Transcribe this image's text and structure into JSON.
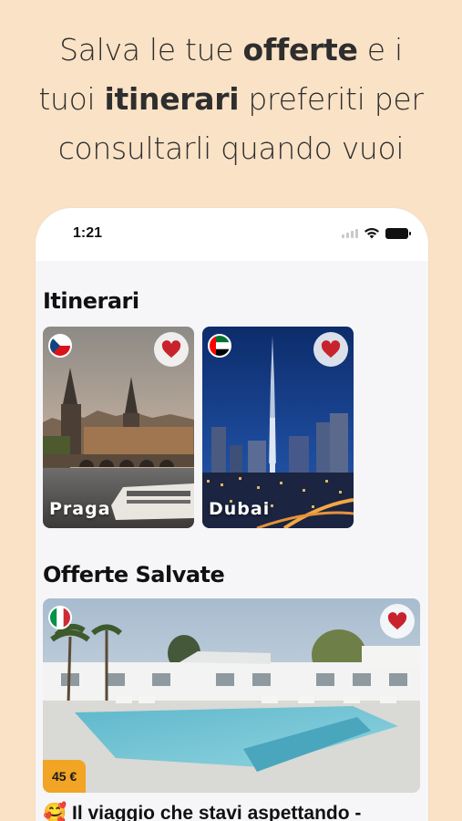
{
  "headline": {
    "line1_pre": "Salva le tue ",
    "line1_bold": "offerte",
    "line1_post": " e i",
    "line2_pre": "tuoi ",
    "line2_bold": "itinerari",
    "line2_post": " preferiti per",
    "line3": "consultarli quando vuoi"
  },
  "status_bar": {
    "time": "1:21",
    "icons": [
      "signal-icon",
      "wifi-icon",
      "battery-icon"
    ]
  },
  "itineraries": {
    "title": "Itinerari",
    "cards": [
      {
        "label": "Praga",
        "flag": "czech-flag",
        "favorite": true
      },
      {
        "label": "Dubai",
        "flag": "uae-flag",
        "favorite": true
      }
    ]
  },
  "saved_offers": {
    "title": "Offerte Salvate",
    "offer": {
      "flag": "italy-flag",
      "price": "45 €",
      "emoji": "🥰",
      "title": "Il viaggio che stavi aspettando -",
      "favorite": true
    }
  },
  "colors": {
    "background": "#fae2c6",
    "heart": "#c8232c",
    "price_badge": "#f2a424"
  }
}
